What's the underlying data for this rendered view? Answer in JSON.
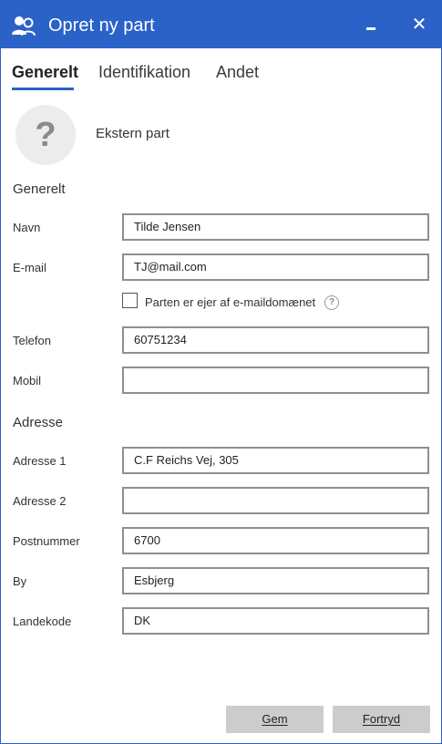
{
  "window": {
    "title": "Opret ny part"
  },
  "titlebar": {
    "close_glyph": "✕"
  },
  "tabs": [
    {
      "label": "Generelt",
      "active": true
    },
    {
      "label": "Identifikation",
      "active": false
    },
    {
      "label": "Andet",
      "active": false
    }
  ],
  "party": {
    "avatar_glyph": "?",
    "type_label": "Ekstern part"
  },
  "sections": {
    "general": "Generelt",
    "address": "Adresse"
  },
  "fields": {
    "name": {
      "label": "Navn",
      "value": "Tilde Jensen"
    },
    "email": {
      "label": "E-mail",
      "value": "TJ@mail.com"
    },
    "owner_checkbox": {
      "label": "Parten er ejer af e-maildomænet",
      "checked": false,
      "help_glyph": "?"
    },
    "phone": {
      "label": "Telefon",
      "value": "60751234"
    },
    "mobile": {
      "label": "Mobil",
      "value": ""
    },
    "address1": {
      "label": "Adresse 1",
      "value": "C.F Reichs Vej, 305"
    },
    "address2": {
      "label": "Adresse 2",
      "value": ""
    },
    "postal_code": {
      "label": "Postnummer",
      "value": "6700"
    },
    "city": {
      "label": "By",
      "value": "Esbjerg"
    },
    "country_code": {
      "label": "Landekode",
      "value": "DK"
    }
  },
  "buttons": {
    "save": "Gem",
    "cancel": "Fortryd"
  },
  "colors": {
    "accent": "#2b62c8",
    "button_bg": "#cccccc",
    "field_border": "#8f8f8f"
  },
  "icons": {
    "app": "contacts-icon",
    "minimize": "minimize-icon",
    "close": "close-icon",
    "help": "help-icon"
  }
}
